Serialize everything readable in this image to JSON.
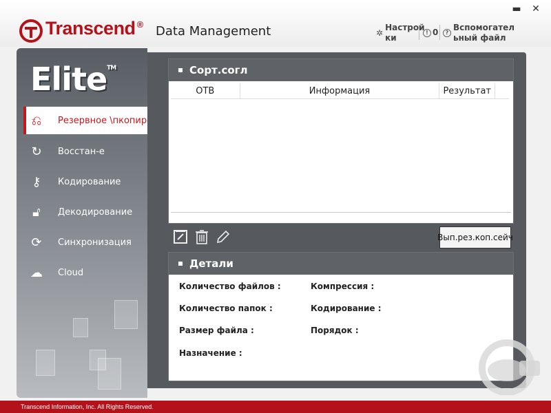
{
  "header": {
    "brand": "Transcend",
    "reg_mark": "®",
    "app_name": "Data Management",
    "settings_label_1": "Настрой",
    "settings_label_2": "ки",
    "about_label": "0",
    "help_label_1": "Вспомогател",
    "help_label_2": "ьный файл",
    "minimize_label": "▬",
    "close_label": "✕"
  },
  "sidebar": {
    "logo_text": "Elite",
    "logo_tm": "TM",
    "items": [
      {
        "label": "Резервное \\пкопир-",
        "icon": "backup-icon",
        "active": true
      },
      {
        "label": "Восстан-е",
        "icon": "restore-icon",
        "active": false
      },
      {
        "label": "Кодирование",
        "icon": "key-icon",
        "active": false
      },
      {
        "label": "Декодирование",
        "icon": "unlock-icon",
        "active": false
      },
      {
        "label": "Синхронизация",
        "icon": "sync-icon",
        "active": false
      },
      {
        "label": "Cloud",
        "icon": "cloud-icon",
        "active": false
      }
    ]
  },
  "backup_panel": {
    "title": "Сорт.согл",
    "columns": [
      "ОТВ",
      "Информация",
      "Результат"
    ],
    "rows": []
  },
  "toolbar": {
    "edit_icon": "edit-file-icon",
    "delete_icon": "trash-icon",
    "pencil_icon": "pencil-icon",
    "run_button": "Вып.рез.коп.сейч"
  },
  "details_panel": {
    "title": "Детали",
    "fields": {
      "file_count": "Количество файлов :",
      "compression": "Компрессия :",
      "folder_count": "Количество папок :",
      "encoding": "Кодирование :",
      "file_size": "Размер файла :",
      "order": "Порядок :",
      "destination": "Назначение :"
    }
  },
  "footer": {
    "copyright": "Transcend Information, Inc. All Rights Reserved."
  },
  "colors": {
    "brand_red": "#b4121b",
    "panel_header": "#5f6266",
    "sidebar_dark": "#585d63"
  }
}
